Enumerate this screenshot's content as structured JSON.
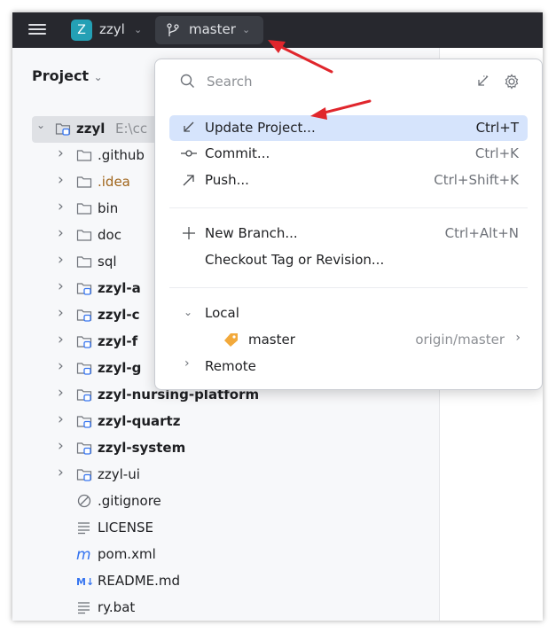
{
  "topbar": {
    "project_badge": "Z",
    "project_name": "zzyl",
    "branch": "master"
  },
  "panel": {
    "title": "Project",
    "tree": [
      {
        "label": "zzyl",
        "extra": "E:\\cc",
        "type": "module",
        "bold": true,
        "expanded": true,
        "level": 0
      },
      {
        "label": ".github",
        "type": "folder",
        "level": 1
      },
      {
        "label": ".idea",
        "type": "folder",
        "level": 1,
        "orange": true
      },
      {
        "label": "bin",
        "type": "folder",
        "level": 1
      },
      {
        "label": "doc",
        "type": "folder",
        "level": 1
      },
      {
        "label": "sql",
        "type": "folder",
        "level": 1
      },
      {
        "label": "zzyl-a",
        "type": "module",
        "bold": true,
        "level": 1
      },
      {
        "label": "zzyl-c",
        "type": "module",
        "bold": true,
        "level": 1
      },
      {
        "label": "zzyl-f",
        "type": "module",
        "bold": true,
        "level": 1
      },
      {
        "label": "zzyl-g",
        "type": "module",
        "bold": true,
        "level": 1
      },
      {
        "label": "zzyl-nursing-platform",
        "type": "module",
        "bold": true,
        "level": 1
      },
      {
        "label": "zzyl-quartz",
        "type": "module",
        "bold": true,
        "level": 1
      },
      {
        "label": "zzyl-system",
        "type": "module",
        "bold": true,
        "level": 1
      },
      {
        "label": "zzyl-ui",
        "type": "module",
        "level": 1
      },
      {
        "label": ".gitignore",
        "type": "gitignore",
        "level": 1,
        "leaf": true
      },
      {
        "label": "LICENSE",
        "type": "text",
        "level": 1,
        "leaf": true
      },
      {
        "label": "pom.xml",
        "type": "maven",
        "level": 1,
        "leaf": true
      },
      {
        "label": "README.md",
        "type": "markdown",
        "level": 1,
        "leaf": true
      },
      {
        "label": "ry.bat",
        "type": "text",
        "level": 1,
        "leaf": true
      }
    ]
  },
  "popup": {
    "search_placeholder": "Search",
    "actions": [
      {
        "label": "Update Project...",
        "shortcut": "Ctrl+T",
        "icon": "update-arrow-icon",
        "highlighted": true
      },
      {
        "label": "Commit...",
        "shortcut": "Ctrl+K",
        "icon": "commit-icon"
      },
      {
        "label": "Push...",
        "shortcut": "Ctrl+Shift+K",
        "icon": "push-arrow-icon"
      }
    ],
    "branch_actions": [
      {
        "label": "New Branch...",
        "shortcut": "Ctrl+Alt+N",
        "icon": "plus-icon"
      },
      {
        "label": "Checkout Tag or Revision...",
        "shortcut": ""
      }
    ],
    "local_label": "Local",
    "local_branch": {
      "name": "master",
      "tracking": "origin/master"
    },
    "remote_label": "Remote"
  },
  "colors": {
    "topbar": "#27282e",
    "highlight": "#d6e4fc",
    "annotation_arrow": "#e0262c",
    "badge": "#24a0b5"
  }
}
